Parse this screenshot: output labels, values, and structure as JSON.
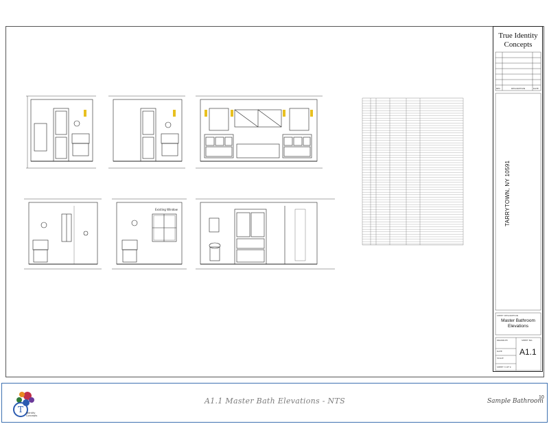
{
  "company": {
    "name_line1": "True Identity",
    "name_line2": "Concepts"
  },
  "revision_table": {
    "headers": [
      "REV",
      "DESCRIPTION",
      "DATE"
    ]
  },
  "project_location": "TARRYTOWN, NY 10591",
  "sheet_description": {
    "label": "SHEET DESCRIPTION",
    "line1": "Master Bathroom",
    "line2": "Elevations"
  },
  "sheet": {
    "number_label": "SHEET NO.",
    "number": "A1.1",
    "drawn_by": "DRAWN BY",
    "date": "DATE",
    "scale": "SCALE",
    "sheet_count": "SHEET 3 OF 9"
  },
  "drawing_notes": {
    "elevation_label": "Existing Window"
  },
  "footer": {
    "title": "A1.1 Master Bath Elevations - NTS",
    "project": "Sample Bathroom",
    "page": "10",
    "logo_text": "True Identity Concepts"
  },
  "colors": {
    "footer_border": "#3b6fb0",
    "footer_title": "#7b7b7b",
    "accent_yellow": "#e8c020"
  }
}
